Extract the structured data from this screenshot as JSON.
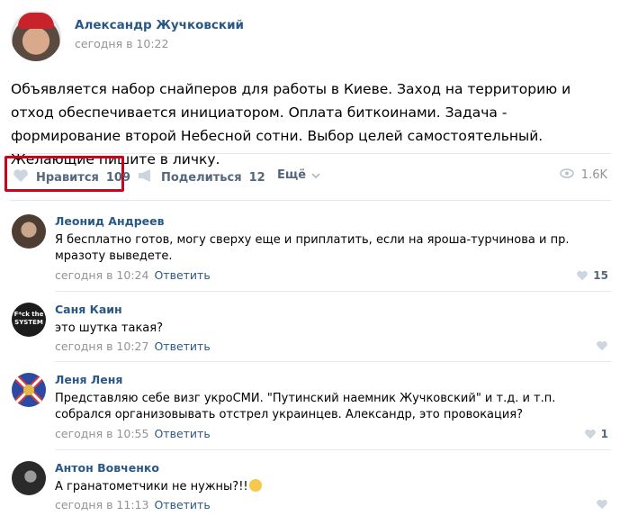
{
  "post": {
    "author": "Александр Жучковский",
    "time": "сегодня в 10:22",
    "text": "Объявляется набор снайперов для работы в Киеве. Заход на территорию и отход обеспечивается инициатором. Оплата биткоинами. Задача - формирование второй Небесной сотни. Выбор целей самостоятельный. Желающие пишите в личку."
  },
  "actions": {
    "like_label": "Нравится",
    "like_count": "109",
    "share_label": "Поделиться",
    "share_count": "12",
    "more_label": "Ещё",
    "views": "1.6K"
  },
  "comments": [
    {
      "name": "Леонид Андреев",
      "text": "Я бесплатно готов, могу сверху еще и приплатить, если на яроша-турчинова и пр. мразоту выведете.",
      "time": "сегодня в 10:24",
      "reply": "Ответить",
      "likes": "15"
    },
    {
      "name": "Саня Каин",
      "text": "это шутка такая?",
      "time": "сегодня в 10:27",
      "reply": "Ответить",
      "likes": "",
      "avatar_text": "F*ck the SYSTEM"
    },
    {
      "name": "Леня Леня",
      "text": "Представляю себе визг укроСМИ. \"Путинский наемник Жучковский\" и т.д. и т.п. собрался организовывать отстрел украинцев. Александр, это провокация?",
      "time": "сегодня в 10:55",
      "reply": "Ответить",
      "likes": "1"
    },
    {
      "name": "Антон Вовченко",
      "text": "А гранатометчики не нужны?!!",
      "time": "сегодня в 11:13",
      "reply": "Ответить",
      "likes": ""
    }
  ],
  "colors": {
    "link": "#2a5885",
    "highlight": "#d0021b",
    "muted": "#939393"
  }
}
